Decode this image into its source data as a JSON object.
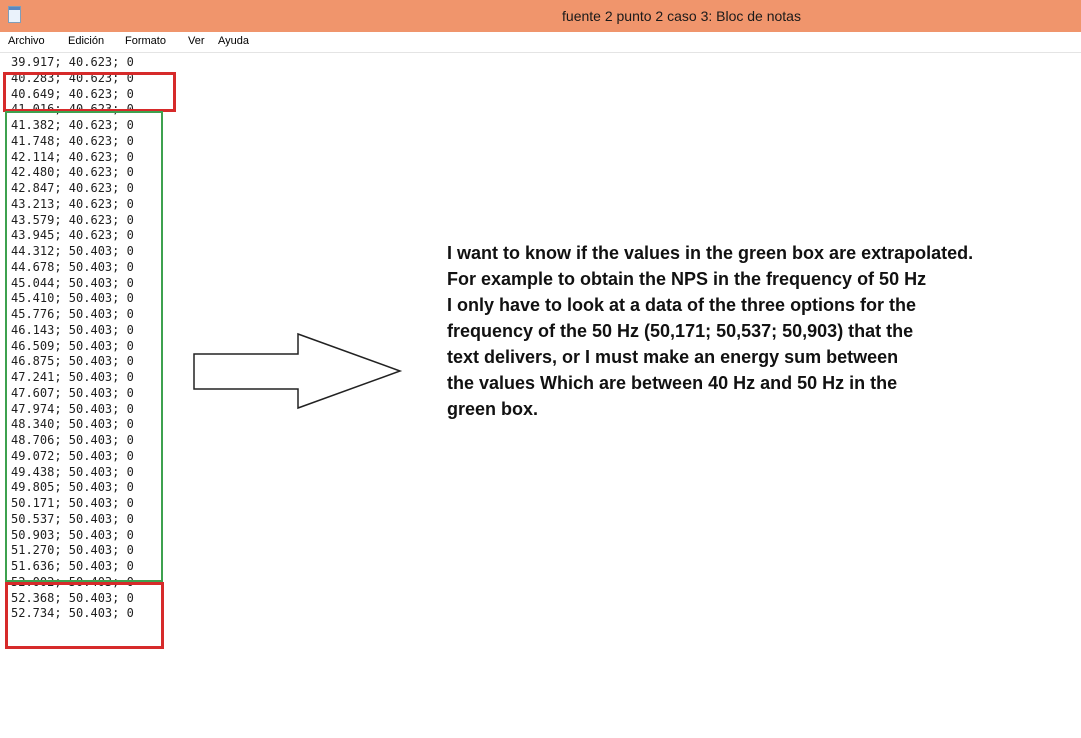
{
  "window": {
    "title": "fuente 2 punto 2 caso 3: Bloc de notas",
    "icon": "notepad-icon",
    "accent": "#f0956c"
  },
  "menu": {
    "items": [
      {
        "label": "Archivo"
      },
      {
        "label": "Edición"
      },
      {
        "label": "Formato"
      },
      {
        "label": "Ver"
      },
      {
        "label": "Ayuda"
      }
    ]
  },
  "editor": {
    "lines": [
      "39.917; 40.623; 0",
      "40.283; 40.623; 0",
      "40.649; 40.623; 0",
      "41.016; 40.623; 0",
      "41.382; 40.623; 0",
      "41.748; 40.623; 0",
      "42.114; 40.623; 0",
      "42.480; 40.623; 0",
      "42.847; 40.623; 0",
      "43.213; 40.623; 0",
      "43.579; 40.623; 0",
      "43.945; 40.623; 0",
      "44.312; 50.403; 0",
      "44.678; 50.403; 0",
      "45.044; 50.403; 0",
      "45.410; 50.403; 0",
      "45.776; 50.403; 0",
      "46.143; 50.403; 0",
      "46.509; 50.403; 0",
      "46.875; 50.403; 0",
      "47.241; 50.403; 0",
      "47.607; 50.403; 0",
      "47.974; 50.403; 0",
      "48.340; 50.403; 0",
      "48.706; 50.403; 0",
      "49.072; 50.403; 0",
      "49.438; 50.403; 0",
      "49.805; 50.403; 0",
      "50.171; 50.403; 0",
      "50.537; 50.403; 0",
      "50.903; 50.403; 0",
      "51.270; 50.403; 0",
      "51.636; 50.403; 0",
      "52.002; 50.403; 0",
      "52.368; 50.403; 0",
      "52.734; 50.403; 0"
    ]
  },
  "annotation": {
    "box_colors": {
      "red": "#d62a2a",
      "green": "#3ea14f"
    },
    "arrow_icon": "right-arrow-icon",
    "note": "I want to know if the values in the green box are extrapolated.\nFor example to obtain the NPS in the frequency of 50 Hz\nI only have to look at a data of the three options for the\nfrequency of the 50 Hz (50,171; 50,537; 50,903) that the\ntext delivers, or I must make an energy sum between\nthe values Which are between 40 Hz and 50 Hz in the\ngreen box."
  }
}
